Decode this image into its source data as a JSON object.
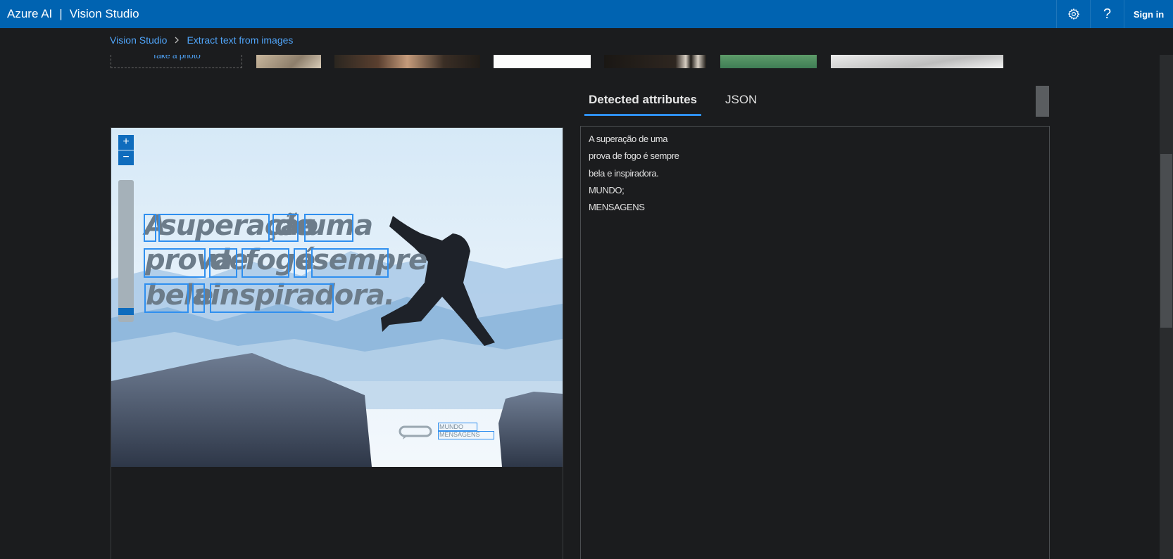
{
  "header": {
    "brand": "Azure AI",
    "separator": "|",
    "product": "Vision Studio",
    "settings_icon": "gear-icon",
    "help_label": "?",
    "signin_label": "Sign in"
  },
  "breadcrumb": {
    "home": "Vision Studio",
    "separator": ">",
    "current": "Extract text from images"
  },
  "gallery": {
    "take_photo": "Take a photo"
  },
  "tabs": [
    {
      "label": "Detected attributes",
      "active": true
    },
    {
      "label": "JSON",
      "active": false
    }
  ],
  "image": {
    "line1": [
      "A",
      "superação",
      "de",
      "uma"
    ],
    "line2": [
      "prova",
      "de",
      "fogo",
      "é",
      "sempre"
    ],
    "line3": [
      "bela",
      "e",
      "inspiradora."
    ],
    "brand_line1": "MUNDO",
    "brand_line2": "MENSAGENS",
    "zoom_in": "+",
    "zoom_out": "−"
  },
  "results": {
    "lines": [
      "A superação de uma",
      "prova de fogo é sempre",
      "bela e inspiradora.",
      "MUNDO;",
      "MENSAGENS"
    ]
  },
  "colors": {
    "topbar": "#0063b1",
    "accent": "#2f8fef",
    "background": "#1b1c1e"
  }
}
